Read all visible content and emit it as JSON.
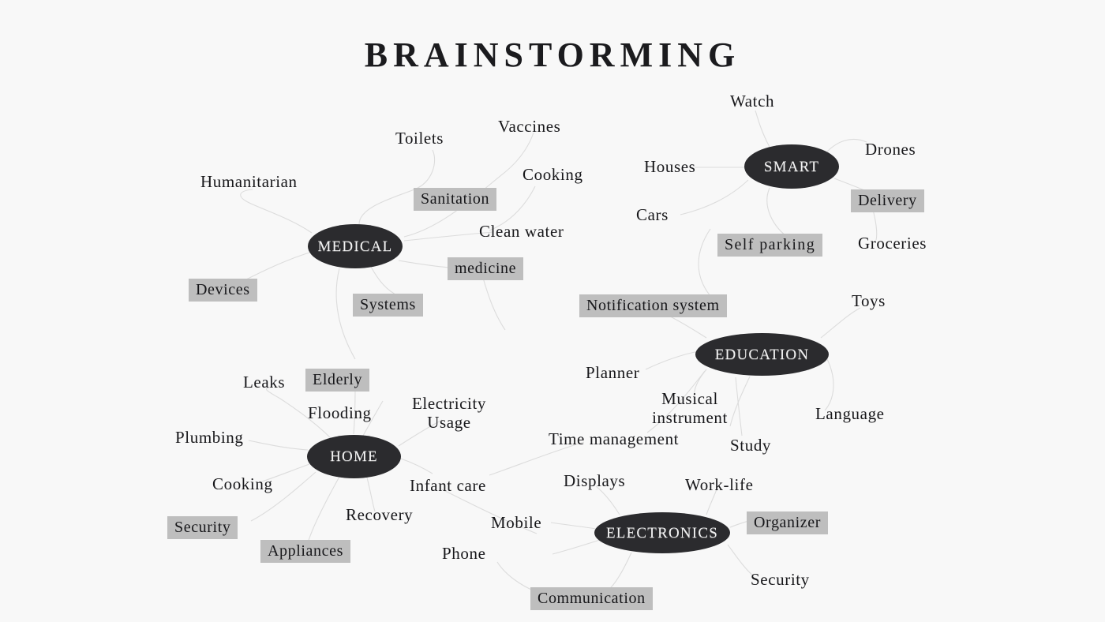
{
  "page": {
    "title": "BRAINSTORMING",
    "background_color": "#f8f8f8",
    "node_fill": "#2b2b2e",
    "node_text_color": "#f4f4f4",
    "highlight_color": "#bebebe",
    "text_color": "#17171a",
    "connector_color": "#dcdcdc"
  },
  "clusters": [
    {
      "id": "medical",
      "label": "MEDICAL",
      "leaves": [
        {
          "label": "Toilets",
          "highlighted": false
        },
        {
          "label": "Vaccines",
          "highlighted": false
        },
        {
          "label": "Humanitarian",
          "highlighted": false
        },
        {
          "label": "Sanitation",
          "highlighted": true
        },
        {
          "label": "Cooking",
          "highlighted": false
        },
        {
          "label": "Clean water",
          "highlighted": false
        },
        {
          "label": "Devices",
          "highlighted": true
        },
        {
          "label": "medicine",
          "highlighted": true
        },
        {
          "label": "Systems",
          "highlighted": true
        }
      ]
    },
    {
      "id": "smart",
      "label": "SMART",
      "leaves": [
        {
          "label": "Watch",
          "highlighted": false
        },
        {
          "label": "Drones",
          "highlighted": false
        },
        {
          "label": "Houses",
          "highlighted": false
        },
        {
          "label": "Delivery",
          "highlighted": true
        },
        {
          "label": "Cars",
          "highlighted": false
        },
        {
          "label": "Self parking",
          "highlighted": true
        },
        {
          "label": "Groceries",
          "highlighted": false
        }
      ]
    },
    {
      "id": "education",
      "label": "EDUCATION",
      "leaves": [
        {
          "label": "Notification system",
          "highlighted": true
        },
        {
          "label": "Toys",
          "highlighted": false
        },
        {
          "label": "Planner",
          "highlighted": false
        },
        {
          "label": "Musical instrument",
          "highlighted": false
        },
        {
          "label": "Language",
          "highlighted": false
        },
        {
          "label": "Time management",
          "highlighted": false
        },
        {
          "label": "Study",
          "highlighted": false
        }
      ]
    },
    {
      "id": "home",
      "label": "HOME",
      "leaves": [
        {
          "label": "Leaks",
          "highlighted": false
        },
        {
          "label": "Elderly",
          "highlighted": true
        },
        {
          "label": "Flooding",
          "highlighted": false
        },
        {
          "label": "Electricity Usage",
          "highlighted": false
        },
        {
          "label": "Plumbing",
          "highlighted": false
        },
        {
          "label": "Cooking",
          "highlighted": false
        },
        {
          "label": "Infant care",
          "highlighted": false
        },
        {
          "label": "Security",
          "highlighted": true
        },
        {
          "label": "Recovery",
          "highlighted": false
        },
        {
          "label": "Appliances",
          "highlighted": true
        }
      ]
    },
    {
      "id": "electronics",
      "label": "ELECTRONICS",
      "leaves": [
        {
          "label": "Displays",
          "highlighted": false
        },
        {
          "label": "Work-life",
          "highlighted": false
        },
        {
          "label": "Mobile",
          "highlighted": false
        },
        {
          "label": "Organizer",
          "highlighted": true
        },
        {
          "label": "Phone",
          "highlighted": false
        },
        {
          "label": "Security",
          "highlighted": false
        },
        {
          "label": "Communication",
          "highlighted": true
        }
      ]
    }
  ],
  "nodes": {
    "medical": "MEDICAL",
    "smart": "SMART",
    "education": "EDUCATION",
    "home": "HOME",
    "electronics": "ELECTRONICS"
  },
  "labels": {
    "toilets": "Toilets",
    "vaccines": "Vaccines",
    "humanitarian": "Humanitarian",
    "sanitation": "Sanitation",
    "cooking_medical": "Cooking",
    "clean_water": "Clean water",
    "devices": "Devices",
    "medicine": "medicine",
    "systems": "Systems",
    "watch": "Watch",
    "drones": "Drones",
    "houses": "Houses",
    "delivery": "Delivery",
    "cars": "Cars",
    "self_parking": "Self parking",
    "groceries": "Groceries",
    "notification_system": "Notification system",
    "toys": "Toys",
    "planner": "Planner",
    "musical_instrument": "Musical instrument",
    "language": "Language",
    "time_management": "Time management",
    "study": "Study",
    "leaks": "Leaks",
    "elderly": "Elderly",
    "flooding": "Flooding",
    "electricity_usage": "Electricity Usage",
    "plumbing": "Plumbing",
    "cooking_home": "Cooking",
    "infant_care": "Infant care",
    "security_home": "Security",
    "recovery": "Recovery",
    "appliances": "Appliances",
    "displays": "Displays",
    "work_life": "Work-life",
    "mobile": "Mobile",
    "organizer": "Organizer",
    "phone": "Phone",
    "security_electronics": "Security",
    "communication": "Communication"
  }
}
